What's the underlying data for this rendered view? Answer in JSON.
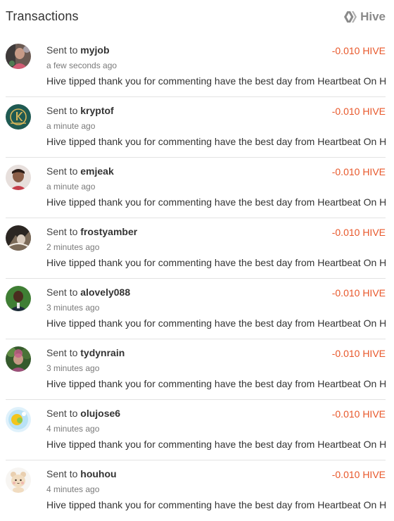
{
  "header": {
    "title": "Transactions",
    "brand_label": "Hive",
    "brand_icon": "hive-logo-icon"
  },
  "colors": {
    "amount": "#e8572a",
    "brand": "#8a8a8a"
  },
  "transactions": [
    {
      "prefix": "Sent to",
      "recipient": "myjob",
      "amount": "-0.010 HIVE",
      "time": "a few seconds ago",
      "memo": "Hive tipped thank you for commenting have the best day from Heartbeat On Hive"
    },
    {
      "prefix": "Sent to",
      "recipient": "kryptof",
      "amount": "-0.010 HIVE",
      "time": "a minute ago",
      "memo": "Hive tipped thank you for commenting have the best day from Heartbeat On Hive"
    },
    {
      "prefix": "Sent to",
      "recipient": "emjeak",
      "amount": "-0.010 HIVE",
      "time": "a minute ago",
      "memo": "Hive tipped thank you for commenting have the best day from Heartbeat On Hive"
    },
    {
      "prefix": "Sent to",
      "recipient": "frostyamber",
      "amount": "-0.010 HIVE",
      "time": "2 minutes ago",
      "memo": "Hive tipped thank you for commenting have the best day from Heartbeat On Hive"
    },
    {
      "prefix": "Sent to",
      "recipient": "alovely088",
      "amount": "-0.010 HIVE",
      "time": "3 minutes ago",
      "memo": "Hive tipped thank you for commenting have the best day from Heartbeat On Hive"
    },
    {
      "prefix": "Sent to",
      "recipient": "tydynrain",
      "amount": "-0.010 HIVE",
      "time": "3 minutes ago",
      "memo": "Hive tipped thank you for commenting have the best day from Heartbeat On Hive"
    },
    {
      "prefix": "Sent to",
      "recipient": "olujose6",
      "amount": "-0.010 HIVE",
      "time": "4 minutes ago",
      "memo": "Hive tipped thank you for commenting have the best day from Heartbeat On Hive"
    },
    {
      "prefix": "Sent to",
      "recipient": "houhou",
      "amount": "-0.010 HIVE",
      "time": "4 minutes ago",
      "memo": "Hive tipped thank you for commenting have the best day from Heartbeat On Hive"
    }
  ]
}
